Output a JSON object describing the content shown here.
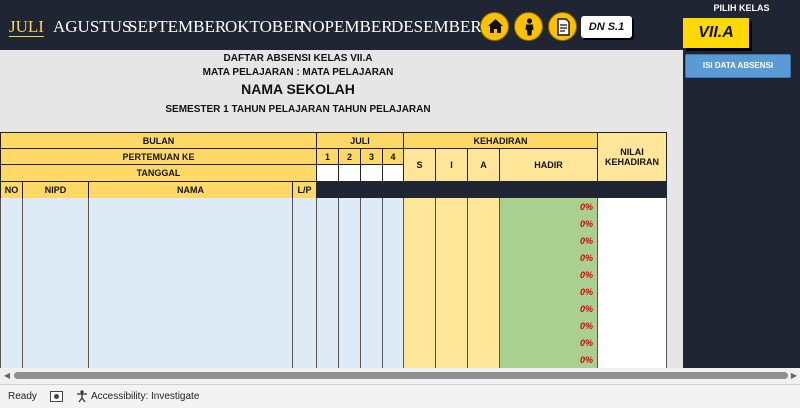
{
  "nav": {
    "months": [
      {
        "label": "JULI",
        "active": true
      },
      {
        "label": "AGUSTUS",
        "active": false
      },
      {
        "label": "SEPTEMBER",
        "active": false
      },
      {
        "label": "OKTOBER",
        "active": false
      },
      {
        "label": "NOPEMBER",
        "active": false
      },
      {
        "label": "DESEMBER",
        "active": false
      }
    ],
    "icons": [
      "home-icon",
      "person-icon",
      "document-icon"
    ],
    "badge": "DN S.1"
  },
  "panel": {
    "class_label": "PILIH KELAS",
    "class_value": "VII.A",
    "fill_button": "ISI DATA ABSENSI"
  },
  "header": {
    "title": "DAFTAR ABSENSI KELAS VII.A",
    "subject": "MATA PELAJARAN : MATA PELAJARAN",
    "school": "NAMA SEKOLAH",
    "semester": "SEMESTER 1 TAHUN PELAJARAN TAHUN PELAJARAN"
  },
  "table": {
    "bulan": "BULAN",
    "month": "JULI",
    "pertemuan": "PERTEMUAN KE",
    "meetings": [
      "1",
      "2",
      "3",
      "4"
    ],
    "tanggal": "TANGGAL",
    "kehadiran": "KEHADIRAN",
    "s": "S",
    "i": "I",
    "a": "A",
    "hadir": "HADIR",
    "nilai": "NILAI",
    "nilai2": "KEHADIRAN",
    "col_no": "NO",
    "col_nipd": "NIPD",
    "col_nama": "NAMA",
    "col_lp": "L/P",
    "rows": [
      "0%",
      "0%",
      "0%",
      "0%",
      "0%",
      "0%",
      "0%",
      "0%",
      "0%",
      "0%"
    ]
  },
  "status": {
    "ready": "Ready",
    "accessibility": "Accessibility: Investigate"
  },
  "colors": {
    "nav_bg": "#1f2533",
    "active_month": "#ffd34d",
    "header_yellow": "#ffd966",
    "light_blue": "#ddebf7",
    "green": "#a9d08e",
    "percent_red": "#e00000"
  }
}
